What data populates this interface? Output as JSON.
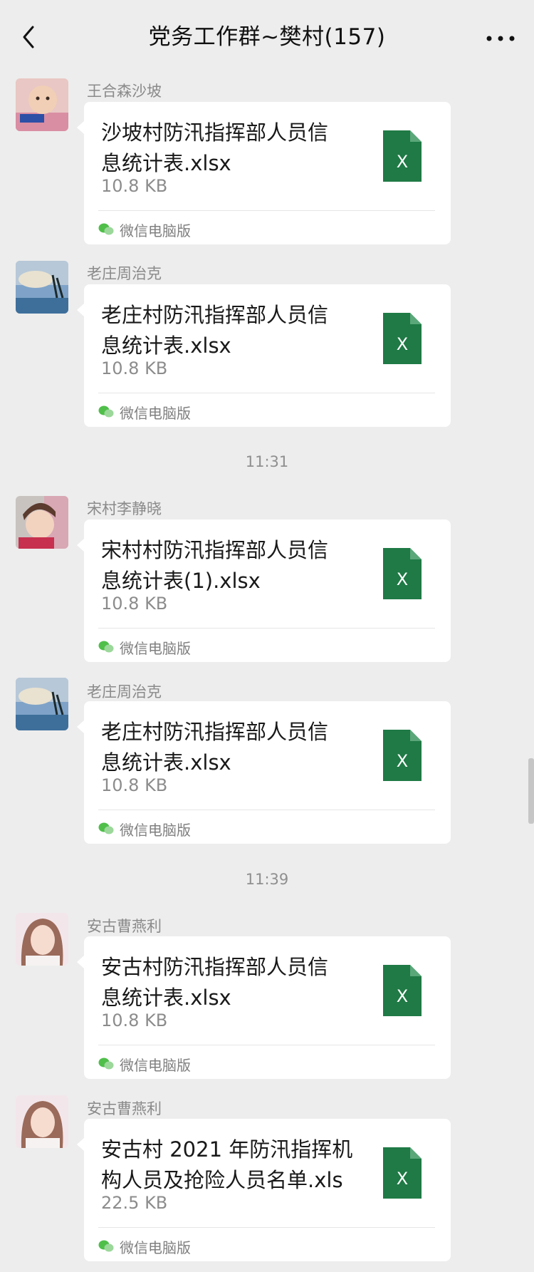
{
  "header": {
    "title": "党务工作群~樊村(157)",
    "back_icon": "chevron-left-icon",
    "more_icon": "more-dots-icon"
  },
  "colors": {
    "background": "#ededed",
    "bubble": "#ffffff",
    "excel_green": "#1f7a45"
  },
  "timestamps": [
    "11:31",
    "11:39"
  ],
  "messages": [
    {
      "sender": "王合森沙坡",
      "file_name": "沙坡村防汛指挥部人员信息统计表.xlsx",
      "file_line1": "沙坡村防汛指挥部人员信",
      "file_line2": "息统计表.xlsx",
      "file_size": "10.8 KB",
      "source": "微信电脑版",
      "file_icon": "excel-file-icon"
    },
    {
      "sender": "老庄周治克",
      "file_name": "老庄村防汛指挥部人员信息统计表.xlsx",
      "file_line1": "老庄村防汛指挥部人员信",
      "file_line2": "息统计表.xlsx",
      "file_size": "10.8 KB",
      "source": "微信电脑版",
      "file_icon": "excel-file-icon"
    },
    {
      "sender": "宋村李静晓",
      "file_name": "宋村村防汛指挥部人员信息统计表(1).xlsx",
      "file_line1": "宋村村防汛指挥部人员信",
      "file_line2": "息统计表(1).xlsx",
      "file_size": "10.8 KB",
      "source": "微信电脑版",
      "file_icon": "excel-file-icon"
    },
    {
      "sender": "老庄周治克",
      "file_name": "老庄村防汛指挥部人员信息统计表.xlsx",
      "file_line1": "老庄村防汛指挥部人员信",
      "file_line2": "息统计表.xlsx",
      "file_size": "10.8 KB",
      "source": "微信电脑版",
      "file_icon": "excel-file-icon"
    },
    {
      "sender": "安古曹燕利",
      "file_name": "安古村防汛指挥部人员信息统计表.xlsx",
      "file_line1": "安古村防汛指挥部人员信",
      "file_line2": "息统计表.xlsx",
      "file_size": "10.8 KB",
      "source": "微信电脑版",
      "file_icon": "excel-file-icon"
    },
    {
      "sender": "安古曹燕利",
      "file_name": "安古村 2021 年防汛指挥机构人员及抢险人员名单.xls",
      "file_line1": "安古村 2021 年防汛指挥机",
      "file_line2": "构人员及抢险人员名单.xls",
      "file_size": "22.5 KB",
      "source": "微信电脑版",
      "file_icon": "excel-file-icon"
    }
  ]
}
